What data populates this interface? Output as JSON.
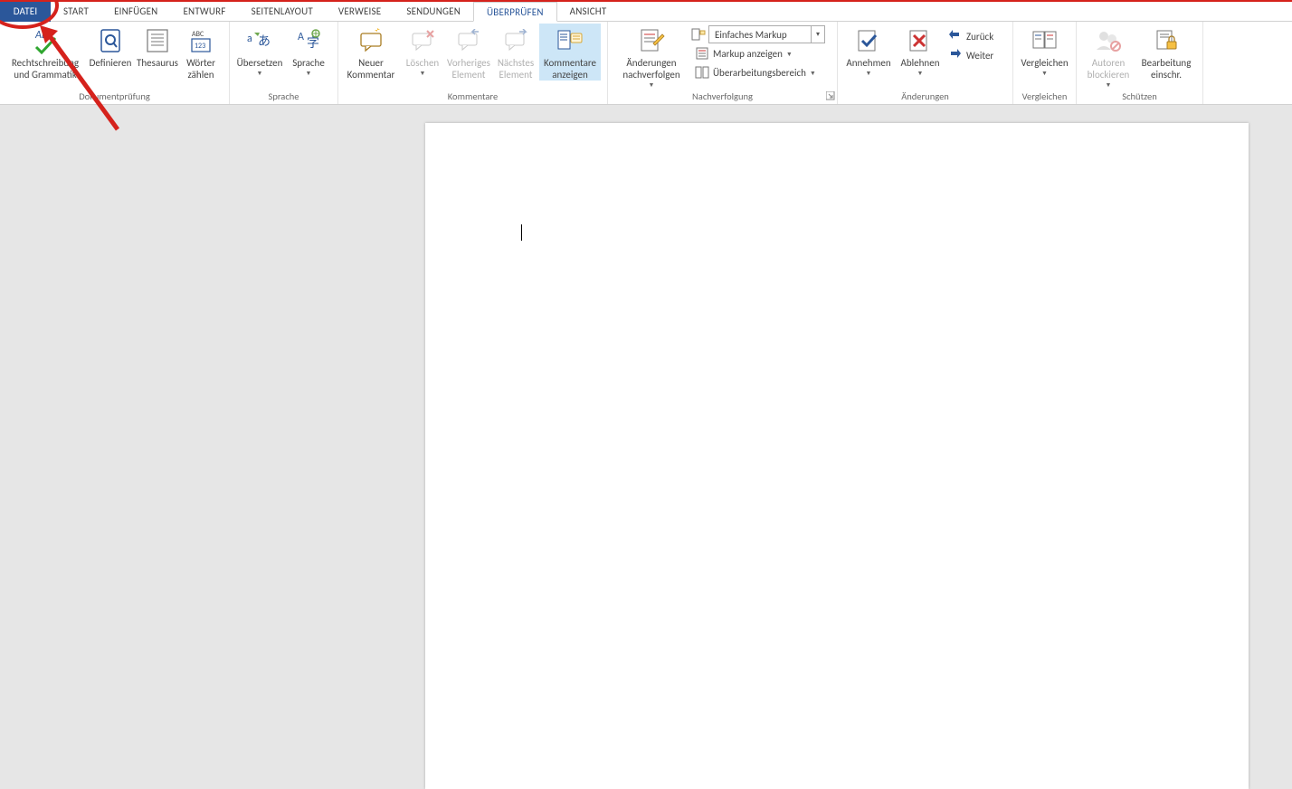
{
  "tabs": {
    "file": "DATEI",
    "items": [
      "START",
      "EINFÜGEN",
      "ENTWURF",
      "SEITENLAYOUT",
      "VERWEISE",
      "SENDUNGEN",
      "ÜBERPRÜFEN",
      "ANSICHT"
    ],
    "active": "ÜBERPRÜFEN"
  },
  "ribbon": {
    "proofing": {
      "title": "Dokumentprüfung",
      "spelling": "Rechtschreibung und Grammatik",
      "define": "Definieren",
      "thesaurus": "Thesaurus",
      "wordcount": "Wörter zählen"
    },
    "language": {
      "title": "Sprache",
      "translate": "Übersetzen",
      "language": "Sprache"
    },
    "comments": {
      "title": "Kommentare",
      "new": "Neuer Kommentar",
      "delete": "Löschen",
      "prev": "Vorheriges Element",
      "next": "Nächstes Element",
      "show": "Kommentare anzeigen"
    },
    "tracking": {
      "title": "Nachverfolgung",
      "track": "Änderungen nachverfolgen",
      "markup_select": "Einfaches Markup",
      "show_markup": "Markup anzeigen",
      "reviewing_pane": "Überarbeitungsbereich"
    },
    "changes": {
      "title": "Änderungen",
      "accept": "Annehmen",
      "reject": "Ablehnen",
      "back": "Zurück",
      "forward": "Weiter"
    },
    "compare": {
      "title": "Vergleichen",
      "compare": "Vergleichen"
    },
    "protect": {
      "title": "Schützen",
      "block": "Autoren blockieren",
      "restrict": "Bearbeitung einschr."
    }
  }
}
